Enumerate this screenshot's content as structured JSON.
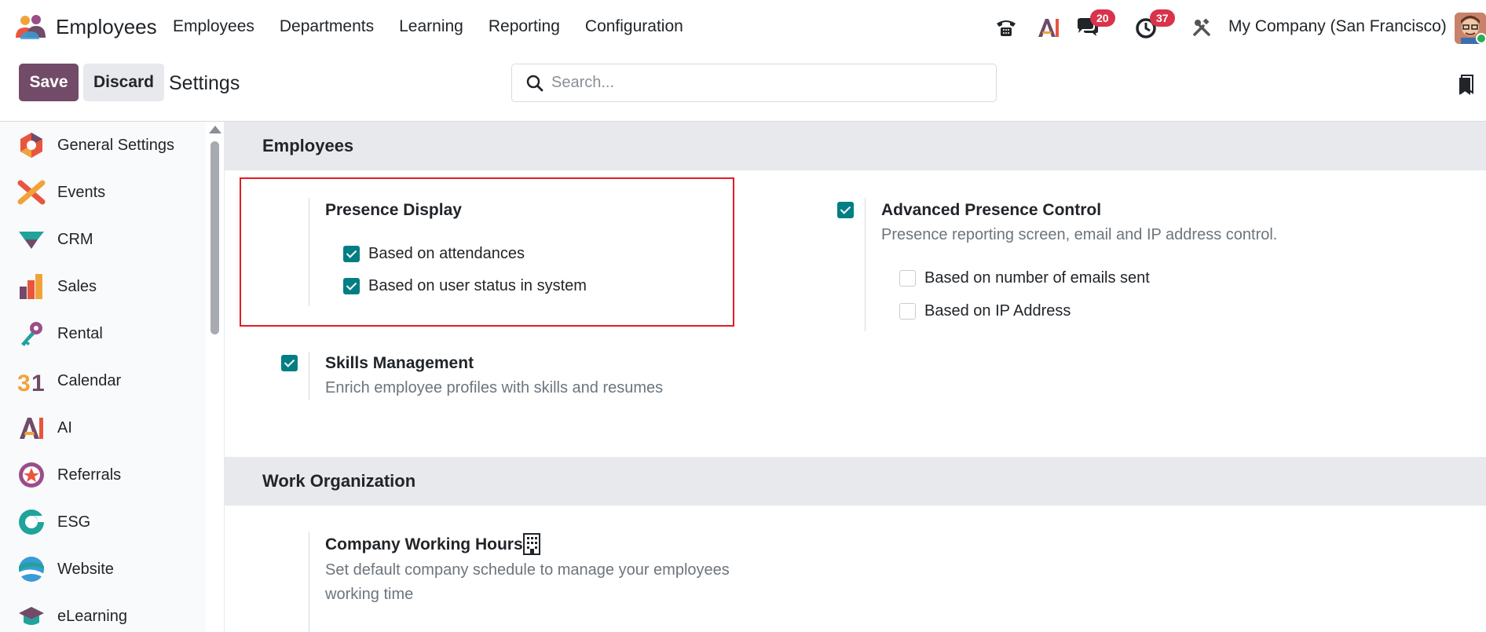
{
  "navbar": {
    "app_title": "Employees",
    "menu": [
      "Employees",
      "Departments",
      "Learning",
      "Reporting",
      "Configuration"
    ],
    "messages_count": "20",
    "activities_count": "37",
    "company": "My Company (San Francisco)"
  },
  "control": {
    "save_label": "Save",
    "discard_label": "Discard",
    "breadcrumb": "Settings",
    "search_placeholder": "Search..."
  },
  "sidebar": {
    "items": [
      {
        "label": "General Settings",
        "icon": "general-settings-icon"
      },
      {
        "label": "Events",
        "icon": "events-icon"
      },
      {
        "label": "CRM",
        "icon": "crm-icon"
      },
      {
        "label": "Sales",
        "icon": "sales-icon"
      },
      {
        "label": "Rental",
        "icon": "rental-icon"
      },
      {
        "label": "Calendar",
        "icon": "calendar-icon"
      },
      {
        "label": "AI",
        "icon": "ai-icon"
      },
      {
        "label": "Referrals",
        "icon": "referrals-icon"
      },
      {
        "label": "ESG",
        "icon": "esg-icon"
      },
      {
        "label": "Website",
        "icon": "website-icon"
      },
      {
        "label": "eLearning",
        "icon": "elearning-icon"
      }
    ]
  },
  "employees_section": {
    "title": "Employees",
    "presence_display": {
      "title": "Presence Display",
      "options": [
        {
          "label": "Based on attendances",
          "checked": true
        },
        {
          "label": "Based on user status in system",
          "checked": true
        }
      ]
    },
    "advanced_presence": {
      "title": "Advanced Presence Control",
      "checked": true,
      "description": "Presence reporting screen, email and IP address control.",
      "options": [
        {
          "label": "Based on number of emails sent",
          "checked": false
        },
        {
          "label": "Based on IP Address",
          "checked": false
        }
      ]
    },
    "skills": {
      "title": "Skills Management",
      "checked": true,
      "description": "Enrich employee profiles with skills and resumes"
    }
  },
  "work_org_section": {
    "title": "Work Organization",
    "working_hours": {
      "title": "Company Working Hours",
      "description_line1": "Set default company schedule to manage your employees",
      "description_line2": "working time"
    }
  },
  "colors": {
    "brand": "#714b67",
    "checkbox": "#017e84",
    "badge": "#d9334b",
    "highlight": "#e31b23"
  }
}
